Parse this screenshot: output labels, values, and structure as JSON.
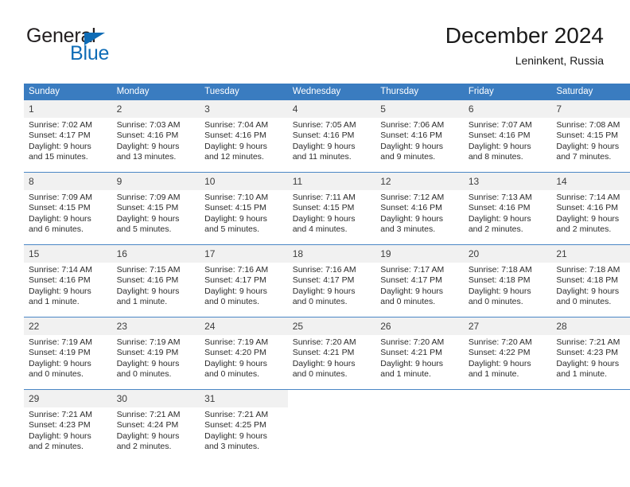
{
  "brand": {
    "name_part1": "General",
    "name_part2": "Blue"
  },
  "header": {
    "title": "December 2024",
    "location": "Leninkent, Russia"
  },
  "colors": {
    "header_blue": "#3a7cc0",
    "brand_blue": "#0f6cb6",
    "daynum_background": "#f1f1f1",
    "row_divider": "#4a86c5"
  },
  "weekdays": [
    "Sunday",
    "Monday",
    "Tuesday",
    "Wednesday",
    "Thursday",
    "Friday",
    "Saturday"
  ],
  "weeks": [
    [
      {
        "day": "1",
        "sunrise": "Sunrise: 7:02 AM",
        "sunset": "Sunset: 4:17 PM",
        "daylight_line1": "Daylight: 9 hours",
        "daylight_line2": "and 15 minutes."
      },
      {
        "day": "2",
        "sunrise": "Sunrise: 7:03 AM",
        "sunset": "Sunset: 4:16 PM",
        "daylight_line1": "Daylight: 9 hours",
        "daylight_line2": "and 13 minutes."
      },
      {
        "day": "3",
        "sunrise": "Sunrise: 7:04 AM",
        "sunset": "Sunset: 4:16 PM",
        "daylight_line1": "Daylight: 9 hours",
        "daylight_line2": "and 12 minutes."
      },
      {
        "day": "4",
        "sunrise": "Sunrise: 7:05 AM",
        "sunset": "Sunset: 4:16 PM",
        "daylight_line1": "Daylight: 9 hours",
        "daylight_line2": "and 11 minutes."
      },
      {
        "day": "5",
        "sunrise": "Sunrise: 7:06 AM",
        "sunset": "Sunset: 4:16 PM",
        "daylight_line1": "Daylight: 9 hours",
        "daylight_line2": "and 9 minutes."
      },
      {
        "day": "6",
        "sunrise": "Sunrise: 7:07 AM",
        "sunset": "Sunset: 4:16 PM",
        "daylight_line1": "Daylight: 9 hours",
        "daylight_line2": "and 8 minutes."
      },
      {
        "day": "7",
        "sunrise": "Sunrise: 7:08 AM",
        "sunset": "Sunset: 4:15 PM",
        "daylight_line1": "Daylight: 9 hours",
        "daylight_line2": "and 7 minutes."
      }
    ],
    [
      {
        "day": "8",
        "sunrise": "Sunrise: 7:09 AM",
        "sunset": "Sunset: 4:15 PM",
        "daylight_line1": "Daylight: 9 hours",
        "daylight_line2": "and 6 minutes."
      },
      {
        "day": "9",
        "sunrise": "Sunrise: 7:09 AM",
        "sunset": "Sunset: 4:15 PM",
        "daylight_line1": "Daylight: 9 hours",
        "daylight_line2": "and 5 minutes."
      },
      {
        "day": "10",
        "sunrise": "Sunrise: 7:10 AM",
        "sunset": "Sunset: 4:15 PM",
        "daylight_line1": "Daylight: 9 hours",
        "daylight_line2": "and 5 minutes."
      },
      {
        "day": "11",
        "sunrise": "Sunrise: 7:11 AM",
        "sunset": "Sunset: 4:15 PM",
        "daylight_line1": "Daylight: 9 hours",
        "daylight_line2": "and 4 minutes."
      },
      {
        "day": "12",
        "sunrise": "Sunrise: 7:12 AM",
        "sunset": "Sunset: 4:16 PM",
        "daylight_line1": "Daylight: 9 hours",
        "daylight_line2": "and 3 minutes."
      },
      {
        "day": "13",
        "sunrise": "Sunrise: 7:13 AM",
        "sunset": "Sunset: 4:16 PM",
        "daylight_line1": "Daylight: 9 hours",
        "daylight_line2": "and 2 minutes."
      },
      {
        "day": "14",
        "sunrise": "Sunrise: 7:14 AM",
        "sunset": "Sunset: 4:16 PM",
        "daylight_line1": "Daylight: 9 hours",
        "daylight_line2": "and 2 minutes."
      }
    ],
    [
      {
        "day": "15",
        "sunrise": "Sunrise: 7:14 AM",
        "sunset": "Sunset: 4:16 PM",
        "daylight_line1": "Daylight: 9 hours",
        "daylight_line2": "and 1 minute."
      },
      {
        "day": "16",
        "sunrise": "Sunrise: 7:15 AM",
        "sunset": "Sunset: 4:16 PM",
        "daylight_line1": "Daylight: 9 hours",
        "daylight_line2": "and 1 minute."
      },
      {
        "day": "17",
        "sunrise": "Sunrise: 7:16 AM",
        "sunset": "Sunset: 4:17 PM",
        "daylight_line1": "Daylight: 9 hours",
        "daylight_line2": "and 0 minutes."
      },
      {
        "day": "18",
        "sunrise": "Sunrise: 7:16 AM",
        "sunset": "Sunset: 4:17 PM",
        "daylight_line1": "Daylight: 9 hours",
        "daylight_line2": "and 0 minutes."
      },
      {
        "day": "19",
        "sunrise": "Sunrise: 7:17 AM",
        "sunset": "Sunset: 4:17 PM",
        "daylight_line1": "Daylight: 9 hours",
        "daylight_line2": "and 0 minutes."
      },
      {
        "day": "20",
        "sunrise": "Sunrise: 7:18 AM",
        "sunset": "Sunset: 4:18 PM",
        "daylight_line1": "Daylight: 9 hours",
        "daylight_line2": "and 0 minutes."
      },
      {
        "day": "21",
        "sunrise": "Sunrise: 7:18 AM",
        "sunset": "Sunset: 4:18 PM",
        "daylight_line1": "Daylight: 9 hours",
        "daylight_line2": "and 0 minutes."
      }
    ],
    [
      {
        "day": "22",
        "sunrise": "Sunrise: 7:19 AM",
        "sunset": "Sunset: 4:19 PM",
        "daylight_line1": "Daylight: 9 hours",
        "daylight_line2": "and 0 minutes."
      },
      {
        "day": "23",
        "sunrise": "Sunrise: 7:19 AM",
        "sunset": "Sunset: 4:19 PM",
        "daylight_line1": "Daylight: 9 hours",
        "daylight_line2": "and 0 minutes."
      },
      {
        "day": "24",
        "sunrise": "Sunrise: 7:19 AM",
        "sunset": "Sunset: 4:20 PM",
        "daylight_line1": "Daylight: 9 hours",
        "daylight_line2": "and 0 minutes."
      },
      {
        "day": "25",
        "sunrise": "Sunrise: 7:20 AM",
        "sunset": "Sunset: 4:21 PM",
        "daylight_line1": "Daylight: 9 hours",
        "daylight_line2": "and 0 minutes."
      },
      {
        "day": "26",
        "sunrise": "Sunrise: 7:20 AM",
        "sunset": "Sunset: 4:21 PM",
        "daylight_line1": "Daylight: 9 hours",
        "daylight_line2": "and 1 minute."
      },
      {
        "day": "27",
        "sunrise": "Sunrise: 7:20 AM",
        "sunset": "Sunset: 4:22 PM",
        "daylight_line1": "Daylight: 9 hours",
        "daylight_line2": "and 1 minute."
      },
      {
        "day": "28",
        "sunrise": "Sunrise: 7:21 AM",
        "sunset": "Sunset: 4:23 PM",
        "daylight_line1": "Daylight: 9 hours",
        "daylight_line2": "and 1 minute."
      }
    ],
    [
      {
        "day": "29",
        "sunrise": "Sunrise: 7:21 AM",
        "sunset": "Sunset: 4:23 PM",
        "daylight_line1": "Daylight: 9 hours",
        "daylight_line2": "and 2 minutes."
      },
      {
        "day": "30",
        "sunrise": "Sunrise: 7:21 AM",
        "sunset": "Sunset: 4:24 PM",
        "daylight_line1": "Daylight: 9 hours",
        "daylight_line2": "and 2 minutes."
      },
      {
        "day": "31",
        "sunrise": "Sunrise: 7:21 AM",
        "sunset": "Sunset: 4:25 PM",
        "daylight_line1": "Daylight: 9 hours",
        "daylight_line2": "and 3 minutes."
      },
      {
        "day": "",
        "sunrise": "",
        "sunset": "",
        "daylight_line1": "",
        "daylight_line2": ""
      },
      {
        "day": "",
        "sunrise": "",
        "sunset": "",
        "daylight_line1": "",
        "daylight_line2": ""
      },
      {
        "day": "",
        "sunrise": "",
        "sunset": "",
        "daylight_line1": "",
        "daylight_line2": ""
      },
      {
        "day": "",
        "sunrise": "",
        "sunset": "",
        "daylight_line1": "",
        "daylight_line2": ""
      }
    ]
  ]
}
